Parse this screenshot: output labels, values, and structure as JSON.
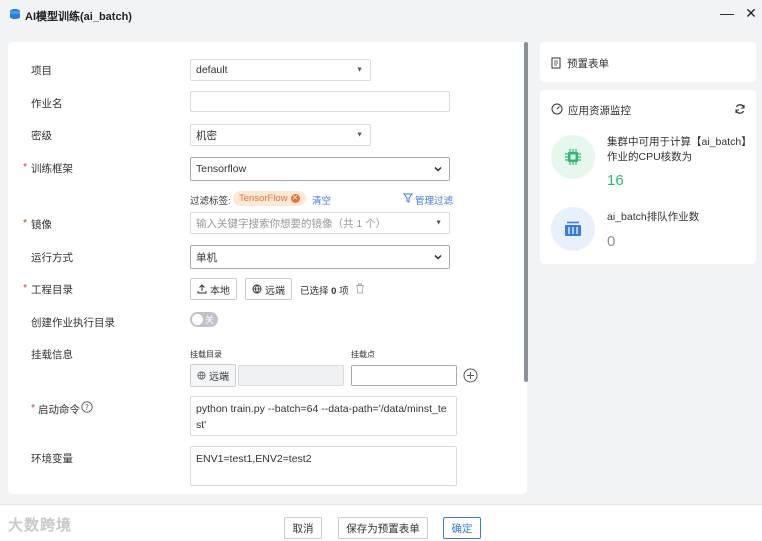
{
  "window": {
    "title": "AI模型训练(ai_batch)",
    "minimize_glyph": "—",
    "close_glyph": "✕"
  },
  "form": {
    "project": {
      "label": "项目",
      "value": "default"
    },
    "job_name": {
      "label": "作业名",
      "value": ""
    },
    "security_level": {
      "label": "密级",
      "value": "机密"
    },
    "framework": {
      "label": "训练框架",
      "value": "Tensorflow"
    },
    "filter": {
      "label": "过滤标签:",
      "tag": "TensorFlow",
      "clear": "清空",
      "manage": "管理过滤"
    },
    "image": {
      "label": "镜像",
      "placeholder": "输入关键字搜索你想要的镜像（共 1 个）"
    },
    "run_mode": {
      "label": "运行方式",
      "value": "单机"
    },
    "project_dir": {
      "label": "工程目录",
      "local_btn": "本地",
      "remote_btn": "远端",
      "selected_prefix": "已选择",
      "selected_count": "0",
      "selected_suffix": "项"
    },
    "create_exec_dir": {
      "label": "创建作业执行目录",
      "toggle_text": "关",
      "enabled": false
    },
    "mount": {
      "label": "挂载信息",
      "mount_dir_header": "挂载目录",
      "mount_point_header": "挂载点",
      "remote_btn": "远端",
      "mount_point_value": ""
    },
    "start_cmd": {
      "label": "启动命令",
      "value": "python train.py --batch=64 --data-path='/data/minst_test'"
    },
    "env_vars": {
      "label": "环境变量",
      "value": "ENV1=test1,ENV2=test2"
    }
  },
  "sidebar": {
    "preset_form": {
      "title": "预置表单"
    },
    "resource_monitor": {
      "title": "应用资源监控",
      "metrics": [
        {
          "label": "集群中可用于计算【ai_batch】作业的CPU核数为",
          "value": "16",
          "color": "#2eb872"
        },
        {
          "label": "ai_batch排队作业数",
          "value": "0",
          "color": "#8a8f99"
        }
      ]
    }
  },
  "footer": {
    "cancel": "取消",
    "save_preset": "保存为预置表单",
    "confirm": "确定",
    "watermark": "大数跨境"
  },
  "colors": {
    "accent": "#3b7be0",
    "required": "#e0392d",
    "tag": "#e8733a",
    "success": "#2eb872"
  }
}
